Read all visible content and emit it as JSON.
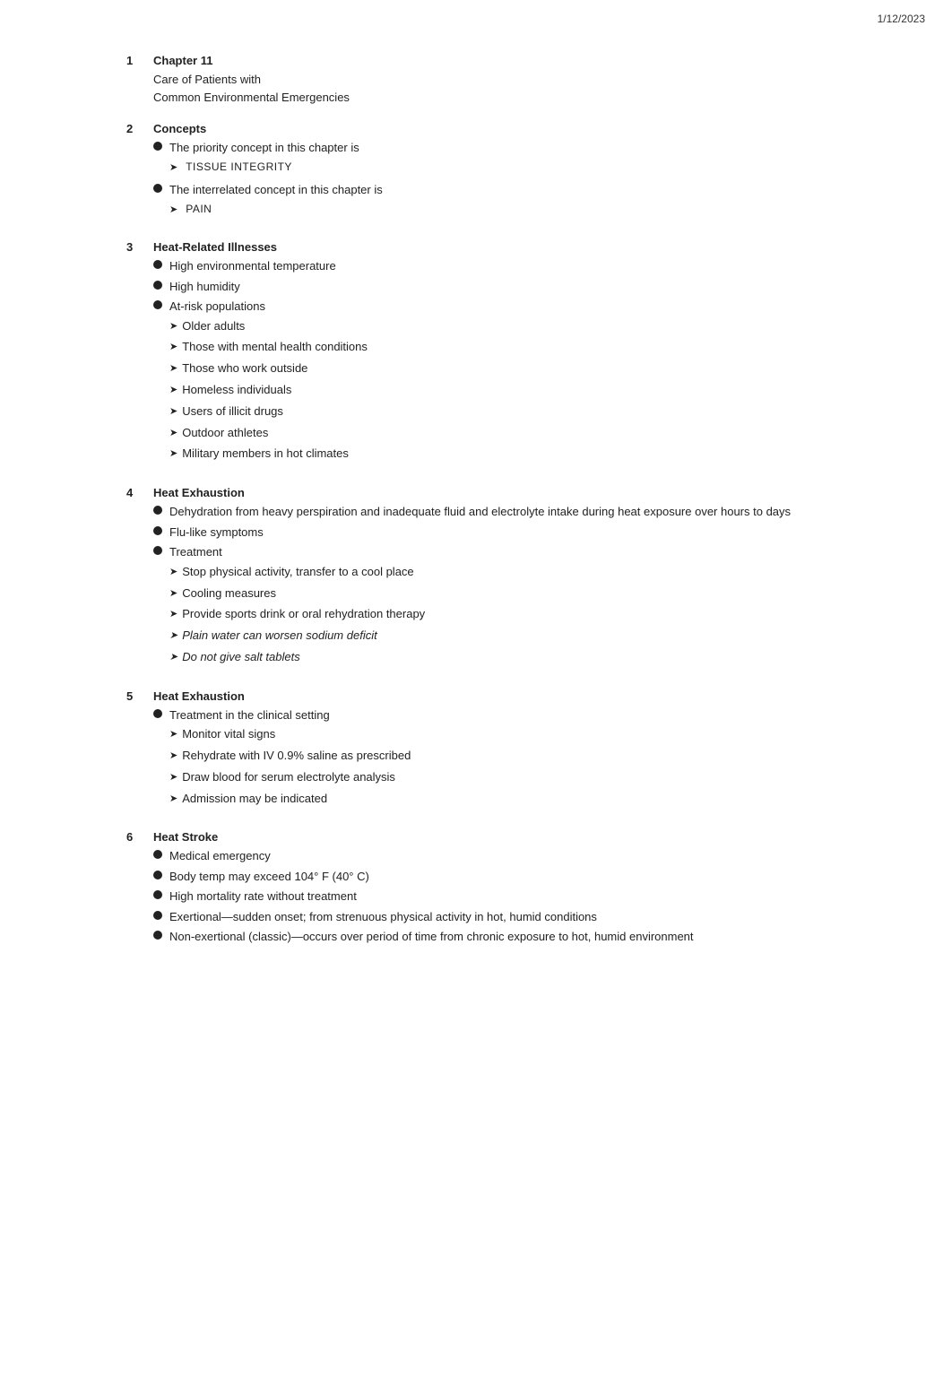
{
  "date": "1/12/2023",
  "sections": [
    {
      "number": "1",
      "title": "Chapter 11",
      "lines": [
        "Care of Patients with",
        "Common Environmental Emergencies"
      ]
    },
    {
      "number": "2",
      "title": "Concepts",
      "bullets": [
        {
          "text": "The priority concept in this chapter is",
          "sub": [
            {
              "text": "TISSUE INTEGRITY",
              "italic": false,
              "smallcaps": true
            }
          ]
        },
        {
          "text": "The interrelated concept in this chapter is",
          "sub": [
            {
              "text": "PAIN",
              "italic": false,
              "smallcaps": true
            }
          ]
        }
      ]
    },
    {
      "number": "3",
      "title": "Heat-Related Illnesses",
      "bullets": [
        {
          "text": "High environmental temperature",
          "sub": []
        },
        {
          "text": "High humidity",
          "sub": []
        },
        {
          "text": "At-risk populations",
          "sub": [
            {
              "text": "Older adults",
              "italic": false
            },
            {
              "text": "Those with mental health conditions",
              "italic": false
            },
            {
              "text": "Those who work outside",
              "italic": false
            },
            {
              "text": "Homeless individuals",
              "italic": false
            },
            {
              "text": "Users of illicit drugs",
              "italic": false
            },
            {
              "text": "Outdoor athletes",
              "italic": false
            },
            {
              "text": "Military members in hot climates",
              "italic": false
            }
          ]
        }
      ]
    },
    {
      "number": "4",
      "title": "Heat Exhaustion",
      "bullets": [
        {
          "text": "Dehydration from heavy perspiration and inadequate fluid and electrolyte intake during heat exposure over hours to days",
          "sub": []
        },
        {
          "text": "Flu-like symptoms",
          "sub": []
        },
        {
          "text": "Treatment",
          "sub": [
            {
              "text": "Stop physical activity, transfer to a cool place",
              "italic": false
            },
            {
              "text": "Cooling measures",
              "italic": false
            },
            {
              "text": "Provide sports drink or oral rehydration therapy",
              "italic": false
            },
            {
              "text": "Plain water can worsen sodium deficit",
              "italic": true
            },
            {
              "text": "Do not give salt tablets",
              "italic": true
            }
          ]
        }
      ]
    },
    {
      "number": "5",
      "title": "Heat Exhaustion",
      "bullets": [
        {
          "text": "Treatment in the clinical setting",
          "sub": [
            {
              "text": "Monitor vital signs",
              "italic": false
            },
            {
              "text": "Rehydrate with IV 0.9% saline as prescribed",
              "italic": false
            },
            {
              "text": "Draw blood for serum electrolyte analysis",
              "italic": false
            },
            {
              "text": "Admission may be indicated",
              "italic": false
            }
          ]
        }
      ]
    },
    {
      "number": "6",
      "title": "Heat Stroke",
      "bullets": [
        {
          "text": "Medical emergency",
          "sub": []
        },
        {
          "text": "Body temp may exceed 104° F (40° C)",
          "sub": []
        },
        {
          "text": "High mortality rate without treatment",
          "sub": []
        },
        {
          "text": "Exertional—sudden onset; from strenuous physical activity in hot, humid conditions",
          "sub": []
        },
        {
          "text": "Non-exertional (classic)—occurs over period of time from chronic exposure to hot, humid environment",
          "sub": []
        }
      ]
    }
  ]
}
